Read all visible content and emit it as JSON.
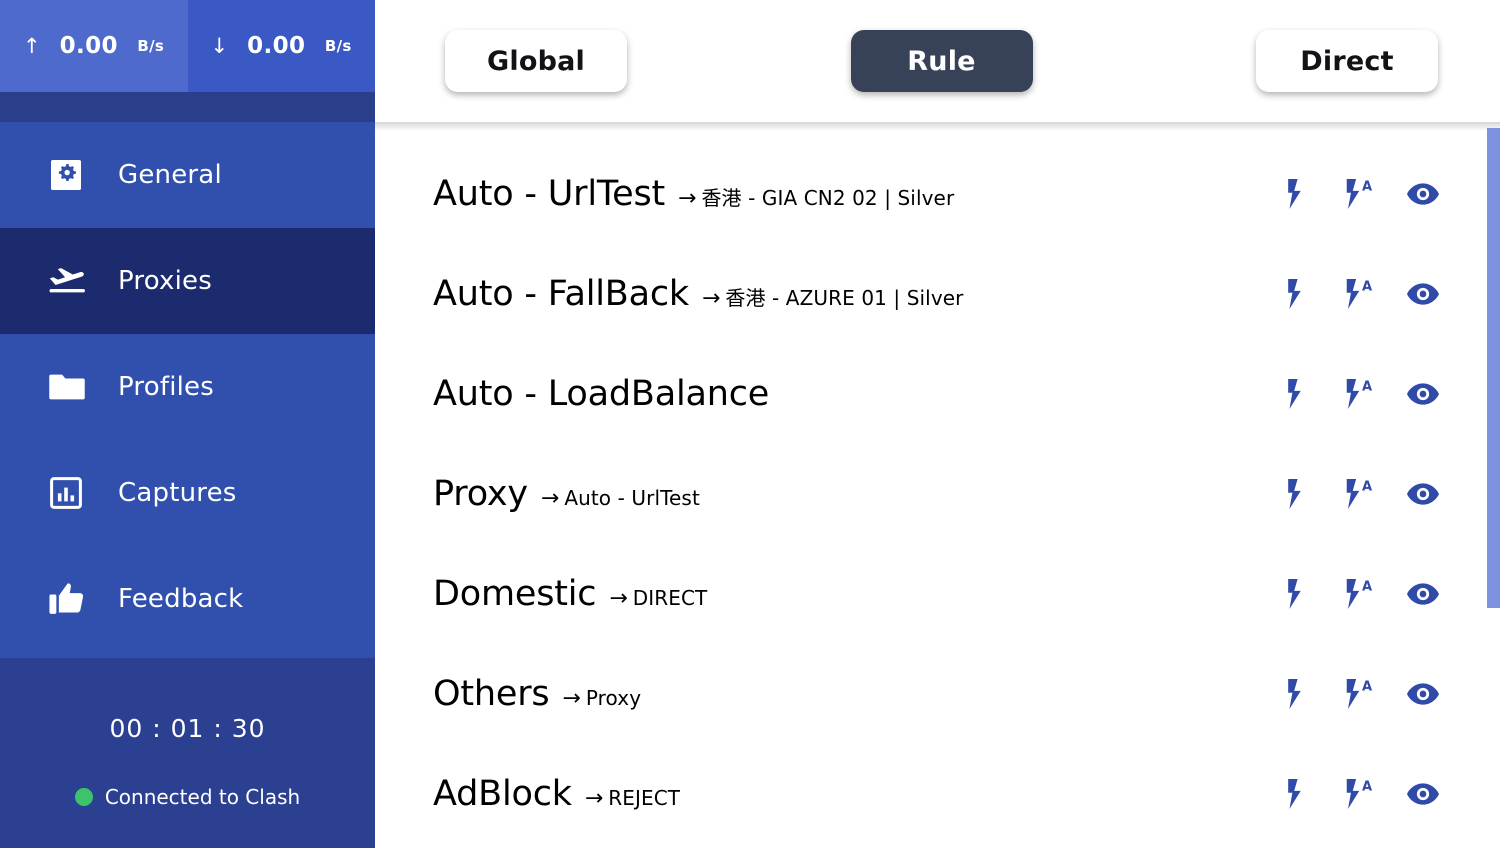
{
  "sidebar": {
    "traffic": {
      "upload": {
        "icon": "arrow-up-icon",
        "arrow": "↑",
        "value": "0.00",
        "unit": "B/s"
      },
      "download": {
        "icon": "arrow-down-icon",
        "arrow": "↓",
        "value": "0.00",
        "unit": "B/s"
      }
    },
    "nav": [
      {
        "id": "general",
        "label": "General",
        "icon": "gear-icon",
        "active": false
      },
      {
        "id": "proxies",
        "label": "Proxies",
        "icon": "plane-icon",
        "active": true
      },
      {
        "id": "profiles",
        "label": "Profiles",
        "icon": "folder-icon",
        "active": false
      },
      {
        "id": "captures",
        "label": "Captures",
        "icon": "chart-icon",
        "active": false
      },
      {
        "id": "feedback",
        "label": "Feedback",
        "icon": "thumbs-up-icon",
        "active": false
      }
    ],
    "footer": {
      "timer": "00 : 01 : 30",
      "status_text": "Connected to Clash",
      "status_color": "#3cc36b"
    }
  },
  "topbar": {
    "tabs": [
      {
        "id": "global",
        "label": "Global",
        "active": false
      },
      {
        "id": "rule",
        "label": "Rule",
        "active": true
      },
      {
        "id": "direct",
        "label": "Direct",
        "active": false
      }
    ]
  },
  "proxy_groups": {
    "arrow": "→",
    "actions": [
      {
        "id": "speed-test",
        "icon": "lightning-bolt-icon"
      },
      {
        "id": "auto-speed-test",
        "icon": "lightning-bolt-auto-icon",
        "badge": "A"
      },
      {
        "id": "toggle-visible",
        "icon": "eye-icon"
      }
    ],
    "rows": [
      {
        "name": "Auto - UrlTest",
        "target": "香港 - GIA CN2 02 | Silver"
      },
      {
        "name": "Auto - FallBack",
        "target": "香港 - AZURE 01 | Silver"
      },
      {
        "name": "Auto - LoadBalance",
        "target": ""
      },
      {
        "name": "Proxy",
        "target": "Auto - UrlTest"
      },
      {
        "name": "Domestic",
        "target": "DIRECT"
      },
      {
        "name": "Others",
        "target": "Proxy"
      },
      {
        "name": "AdBlock",
        "target": "REJECT"
      }
    ]
  },
  "colors": {
    "sidebar_bg": "#3150ad",
    "sidebar_active": "#1b2b6e",
    "sidebar_footer": "#2c4091",
    "upload_bg": "#4e6acd",
    "download_bg": "#3a59c4",
    "navy_strip": "#2a3f8a",
    "tab_active_bg": "#374158",
    "accent_icon": "#2f4aa8",
    "scrollbar_thumb": "#7d93e0"
  }
}
